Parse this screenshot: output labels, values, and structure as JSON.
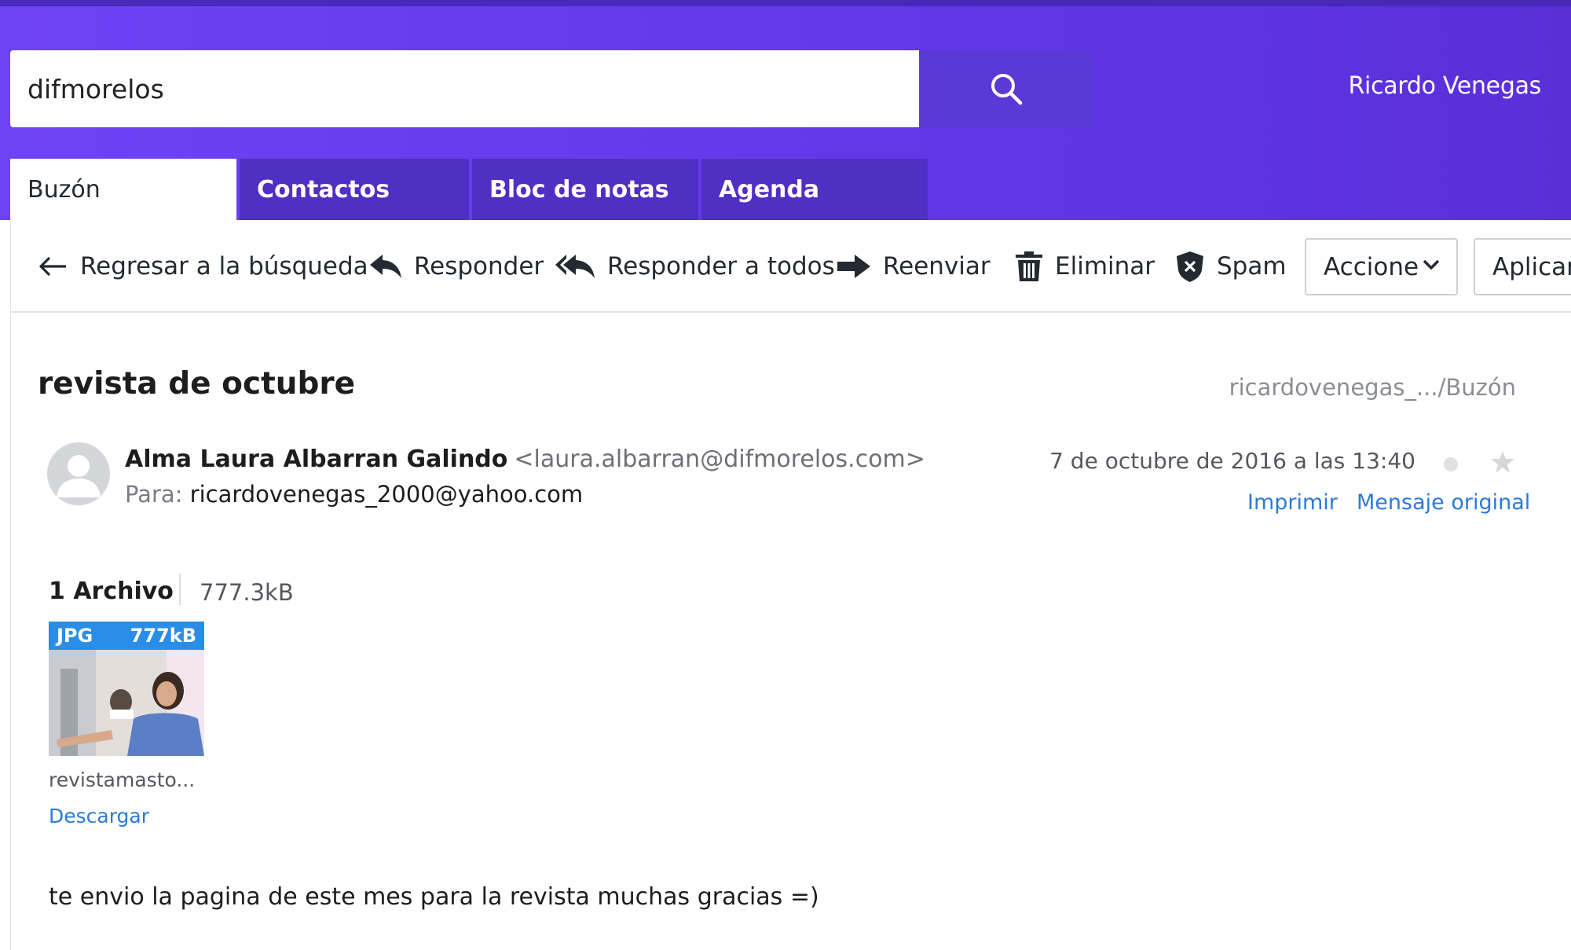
{
  "search": {
    "query": "difmorelos"
  },
  "header": {
    "user_name": "Ricardo Venegas"
  },
  "tabs": [
    {
      "label": "Buzón",
      "active": true
    },
    {
      "label": "Contactos",
      "active": false
    },
    {
      "label": "Bloc de notas",
      "active": false
    },
    {
      "label": "Agenda",
      "active": false
    }
  ],
  "toolbar": {
    "back_label": "Regresar a la búsqueda",
    "reply_label": "Responder",
    "reply_all_label": "Responder a todos",
    "forward_label": "Reenviar",
    "delete_label": "Eliminar",
    "spam_label": "Spam",
    "actions_select": "Accione",
    "apply_label": "Aplicar"
  },
  "message": {
    "subject": "revista de octubre",
    "folder_path": "ricardovenegas_.../Buzón",
    "sender_name": "Alma Laura Albarran Galindo",
    "sender_email": "<laura.albarran@difmorelos.com>",
    "to_label": "Para:",
    "to_address": "ricardovenegas_2000@yahoo.com",
    "date": "7 de octubre de 2016 a las 13:40",
    "print_label": "Imprimir",
    "original_label": "Mensaje original",
    "body": "te envio la pagina de este mes para la revista muchas gracias =)"
  },
  "attachments": {
    "count_label": "1 Archivo",
    "total_size": "777.3kB",
    "items": [
      {
        "type": "JPG",
        "size": "777kB",
        "name": "revistamasto...",
        "download_label": "Descargar"
      }
    ]
  },
  "colors": {
    "header_gradient_start": "#6e42f5",
    "header_gradient_end": "#5a2fd8",
    "tab_inactive": "#4f2fc4",
    "link": "#2d7ad6",
    "thumb_badge": "#2a8ee8"
  },
  "icons": {
    "search": "search-icon",
    "back": "arrow-left-icon",
    "reply": "reply-icon",
    "reply_all": "reply-all-icon",
    "forward": "forward-icon",
    "delete": "trash-icon",
    "spam": "shield-icon",
    "select": "chevron-down-icon",
    "avatar": "user-avatar-icon",
    "star": "star-icon"
  }
}
